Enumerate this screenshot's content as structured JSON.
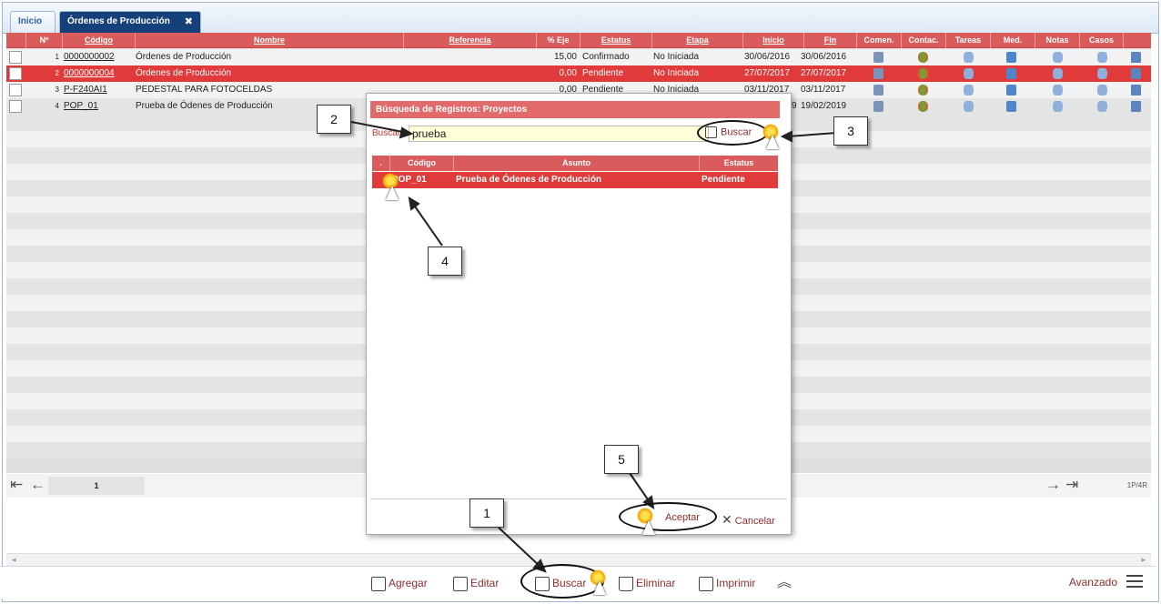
{
  "tabs": [
    {
      "label": "Inicio"
    },
    {
      "label": "Órdenes de Producción"
    }
  ],
  "columns": [
    ".",
    "Nº",
    "Código",
    "Nombre",
    "Referencia",
    "% Eje",
    "Estatus",
    "Etapa",
    "Inicio",
    "Fin",
    "Comen.",
    "Contac.",
    "Tareas",
    "Med.",
    "Notas",
    "Casos"
  ],
  "rows": [
    {
      "n": "1",
      "codigo": "0000000002",
      "nombre": "Órdenes de Producción",
      "referencia": "",
      "eje": "15,00",
      "estatus": "Confirmado",
      "etapa": "No Iniciada",
      "inicio": "30/06/2016",
      "fin": "30/06/2016"
    },
    {
      "n": "2",
      "codigo": "0000000004",
      "nombre": "Órdenes de Producción",
      "referencia": "",
      "eje": "0,00",
      "estatus": "Pendiente",
      "etapa": "No Iniciada",
      "inicio": "27/07/2017",
      "fin": "27/07/2017"
    },
    {
      "n": "3",
      "codigo": "P-F240AI1",
      "nombre": "PEDESTAL PARA FOTOCELDAS",
      "referencia": "",
      "eje": "0,00",
      "estatus": "Pendiente",
      "etapa": "No Iniciada",
      "inicio": "03/11/2017",
      "fin": "03/11/2017"
    },
    {
      "n": "4",
      "codigo": "POP_01",
      "nombre": "Prueba de Ódenes de Producción",
      "referencia": "",
      "eje": "",
      "estatus": "",
      "etapa": "",
      "inicio": "9",
      "fin": "19/02/2019"
    }
  ],
  "pager": {
    "page": "1",
    "info": "1P/4R"
  },
  "toolbar": {
    "agregar": "Agregar",
    "editar": "Editar",
    "buscar": "Buscar",
    "eliminar": "Eliminar",
    "imprimir": "Imprimir",
    "avanzado": "Avanzado"
  },
  "dialog": {
    "title": "Búsqueda de Registros: Proyectos",
    "search_label": "Buscar:",
    "search_value": "prueba",
    "search_button": "Buscar",
    "columns": [
      ".",
      "Código",
      "Asunto",
      "Estatus"
    ],
    "row": {
      "codigo": "POP_01",
      "asunto": "Prueba de Ódenes de Producción",
      "estatus": "Pendiente"
    },
    "accept": "Aceptar",
    "cancel": "Cancelar"
  },
  "callouts": [
    "1",
    "2",
    "3",
    "4",
    "5"
  ],
  "colors": {
    "header": "#d95b5b",
    "selected_row": "#e03a3a",
    "tab_active": "#16407a",
    "link_text": "#8b2e2e"
  }
}
